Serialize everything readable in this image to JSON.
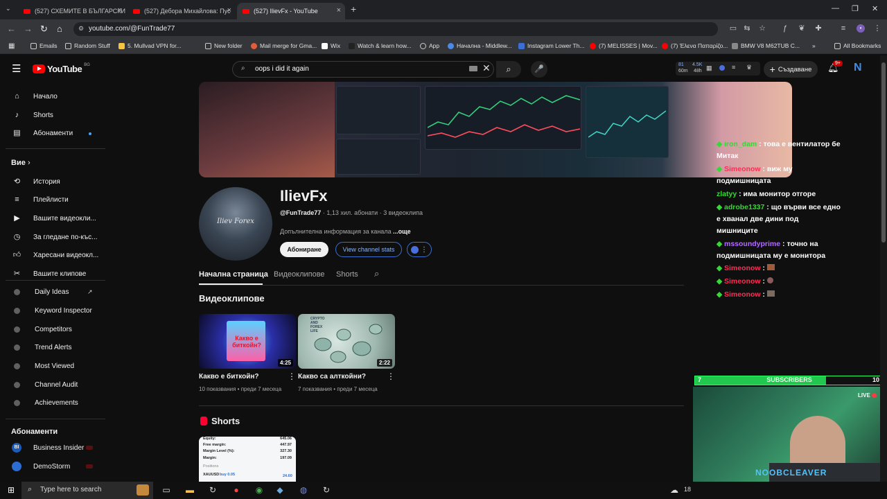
{
  "browser": {
    "tabs": [
      {
        "title": "(527) СХЕМИТЕ В БЪЛГАРСКИ"
      },
      {
        "title": "(527) Дебора Михайлова: Пус"
      },
      {
        "title": "(527) IlievFx - YouTube"
      }
    ],
    "new_tab_symbol": "+",
    "url": "youtube.com/@FunTrade77",
    "bookmarks": [
      {
        "label": "Emails"
      },
      {
        "label": "Random Stuff"
      },
      {
        "label": "5. Mullvad VPN for..."
      },
      {
        "label": "New folder"
      },
      {
        "label": "Mail merge for Gma..."
      },
      {
        "label": "Wix"
      },
      {
        "label": "Watch & learn how..."
      },
      {
        "label": "App"
      },
      {
        "label": "Начална - Middlew..."
      },
      {
        "label": "Instagram Lower Th..."
      },
      {
        "label": "(7) MELISSES | Mov..."
      },
      {
        "label": "(7) Έλενα Παπαρίζο..."
      },
      {
        "label": "BMW V8 M62TUB C..."
      }
    ],
    "all_bookmarks": "All Bookmarks"
  },
  "youtube": {
    "logo_text": "YouTube",
    "country": "BG",
    "search_value": "oops i did it again",
    "header_stats": {
      "top1": "81",
      "bottom1": "60m",
      "top2": "4.5K",
      "bottom2": "48h"
    },
    "create_label": "Създаване",
    "notif_count": "9+",
    "avatar_letter": "N"
  },
  "sidebar": {
    "main": [
      {
        "label": "Начало"
      },
      {
        "label": "Shorts"
      },
      {
        "label": "Абонаменти"
      }
    ],
    "you_header": "Вие",
    "you": [
      {
        "label": "История"
      },
      {
        "label": "Плейлисти"
      },
      {
        "label": "Вашите видеокли..."
      },
      {
        "label": "За гледане по-къс..."
      },
      {
        "label": "Харесани видеокл..."
      },
      {
        "label": "Вашите клипове"
      }
    ],
    "tools": [
      {
        "label": "Daily Ideas"
      },
      {
        "label": "Keyword Inspector"
      },
      {
        "label": "Competitors"
      },
      {
        "label": "Trend Alerts"
      },
      {
        "label": "Most Viewed"
      },
      {
        "label": "Channel Audit"
      },
      {
        "label": "Achievements"
      }
    ],
    "subs_header": "Абонаменти",
    "subs": [
      {
        "label": "Business Insider",
        "badge": "BI"
      },
      {
        "label": "DemoStorm"
      }
    ]
  },
  "channel": {
    "avatar_text": "Iliev Forex",
    "name": "IlievFx",
    "handle": "@FunTrade77",
    "subscribers": "1,13 хил. абонати",
    "videos_count": "3 видеоклипа",
    "more_info": "Допълнителна информация за канала",
    "more_link": "...още",
    "subscribe_label": "Абониране",
    "stats_label": "View channel stats",
    "tabs": [
      {
        "label": "Начална страница"
      },
      {
        "label": "Видеоклипове"
      },
      {
        "label": "Shorts"
      }
    ],
    "videos_header": "Видеоклипове",
    "videos": [
      {
        "title": "Какво е биткойн?",
        "duration": "4:25",
        "views": "10 показвания",
        "age": "преди 7 месеца",
        "thumb_text": "Какво е биткойн?"
      },
      {
        "title": "Какво са алткойни?",
        "duration": "2:22",
        "views": "7 показвания",
        "age": "преди 7 месеца",
        "thumb_text": "CRYPTO AND FOREX LIFE"
      }
    ],
    "shorts_header": "Shorts",
    "short_preview": {
      "rows": [
        {
          "k": "Equity:",
          "v": "645.06"
        },
        {
          "k": "Free margin:",
          "v": "447.97"
        },
        {
          "k": "Margin Level (%):",
          "v": "327.30"
        },
        {
          "k": "Margin:",
          "v": "197.09"
        }
      ],
      "label": "Positions",
      "symbol": "XAUUSD",
      "order": "buy 0.05",
      "profit": "24.60"
    }
  },
  "chat": {
    "messages": [
      {
        "user": "iron_dam",
        "text": "това е вентилатор бе Митак",
        "color": "#35d835"
      },
      {
        "user": "Simeonow",
        "text": "виж му подмишницата",
        "color": "#ff2d55"
      },
      {
        "user": "zlatyy",
        "text": "има монитор отгоре",
        "color": "#35d835"
      },
      {
        "user": "adrobe1337",
        "text": "що върви все едно е хванал две дини под мишниците",
        "color": "#35d835"
      },
      {
        "user": "mssoundyprime",
        "text": "точно на подмишницата му е монитора",
        "color": "#b36bff"
      },
      {
        "user": "Simeonow",
        "text": "",
        "color": "#ff2d55"
      },
      {
        "user": "Simeonow",
        "text": "",
        "color": "#ff2d55"
      },
      {
        "user": "Simeonow",
        "text": "",
        "color": "#ff2d55"
      }
    ]
  },
  "overlay": {
    "sub_goal_left": "7",
    "sub_goal_label": "SUBSCRIBERS",
    "sub_goal_right": "10",
    "sub_goal_progress": 0.7,
    "live": "LIVE",
    "streamer": "NOOBCLEAVER"
  },
  "taskbar": {
    "search_placeholder": "Type here to search",
    "temperature": "18"
  }
}
